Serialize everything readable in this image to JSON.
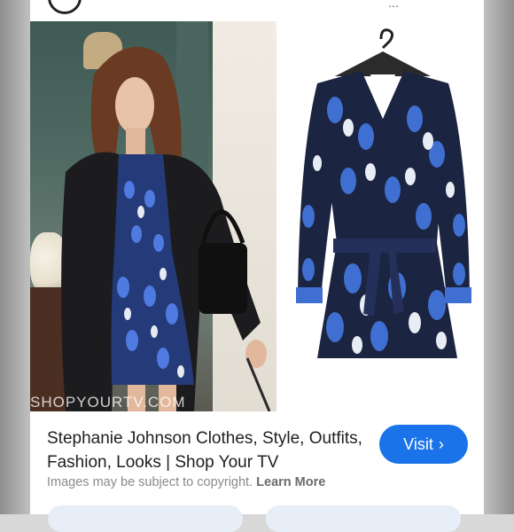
{
  "result": {
    "title": "Stephanie Johnson Clothes, Style, Outfits, Fashion, Looks | Shop Your TV",
    "visit_label": "Visit",
    "visit_icon": "chevron-right-icon",
    "copyright_text": "Images may be subject to copyright.",
    "learn_more": "Learn More"
  },
  "image": {
    "watermark": "SHOPYOURTV.COM"
  },
  "colors": {
    "accent": "#1a73e8",
    "dress_dark": "#1b2440",
    "dress_blue": "#3f6fd0",
    "dress_light": "#e8ecf4"
  }
}
